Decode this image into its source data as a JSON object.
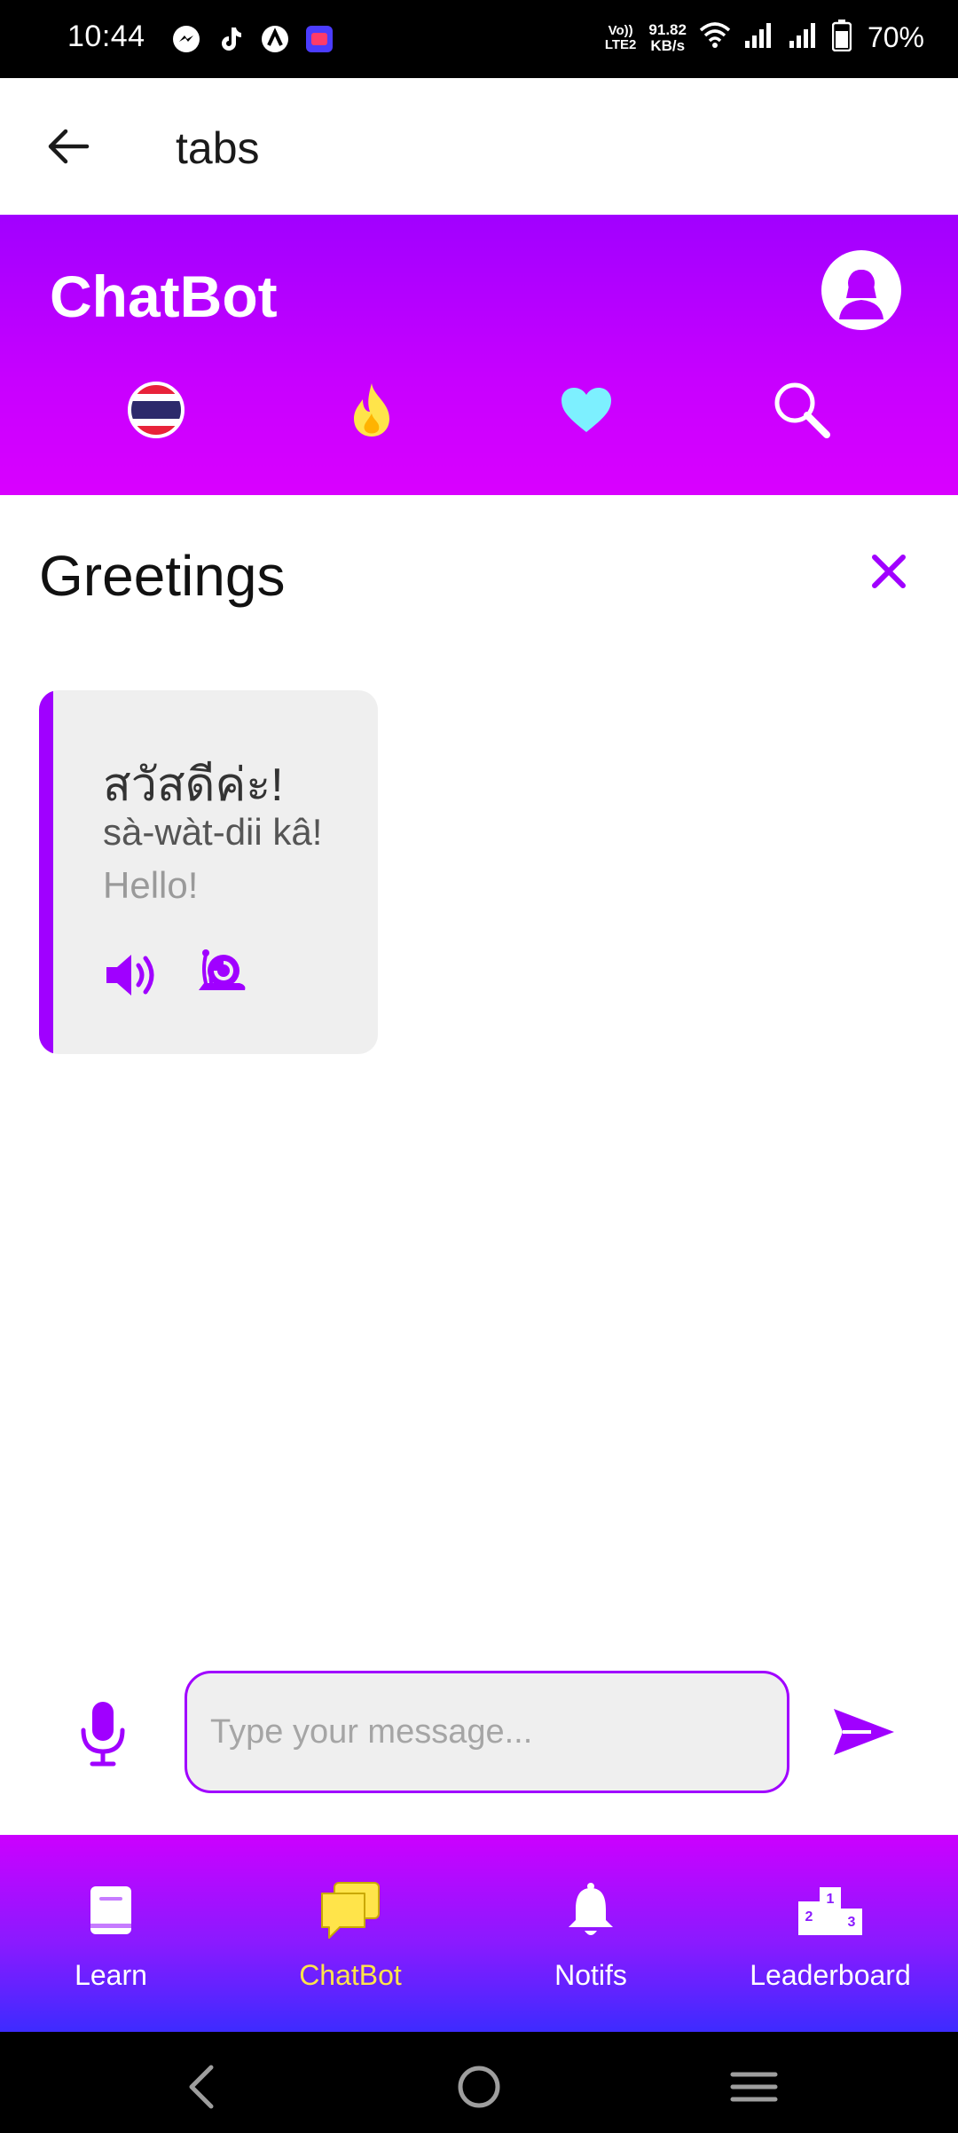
{
  "status_bar": {
    "time": "10:44",
    "notification_icons": [
      "messenger-icon",
      "tiktok-icon",
      "arc-icon",
      "lazada-icon"
    ],
    "volte": [
      "Vo))",
      "LTE2"
    ],
    "speed": [
      "91.82",
      "KB/s"
    ],
    "battery": "70%"
  },
  "app_bar": {
    "title": "tabs"
  },
  "chat_header": {
    "brand": "ChatBot",
    "icons": [
      "thailand-flag-icon",
      "fire-icon",
      "heart-icon",
      "search-icon"
    ]
  },
  "section": {
    "title": "Greetings"
  },
  "card": {
    "thai": "สวัสดีค่ะ!",
    "romanization": "sà-wàt-dii kâ!",
    "english": "Hello!"
  },
  "input": {
    "placeholder": "Type your message..."
  },
  "bottom_nav": {
    "items": [
      {
        "label": "Learn",
        "icon": "book-icon"
      },
      {
        "label": "ChatBot",
        "icon": "chat-icon",
        "active": true
      },
      {
        "label": "Notifs",
        "icon": "bell-icon"
      },
      {
        "label": "Leaderboard",
        "icon": "podium-icon"
      }
    ]
  },
  "colors": {
    "accent": "#a000ff",
    "active_tab": "#ffe44a",
    "fire": "#ffe44a",
    "heart": "#7df0ff"
  }
}
